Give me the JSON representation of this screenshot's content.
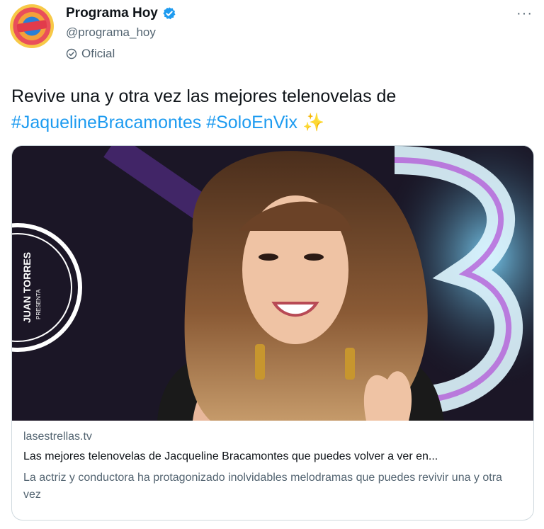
{
  "tweet": {
    "author_name": "Programa Hoy",
    "author_handle": "@programa_hoy",
    "official_label": "Oficial",
    "more_glyph": "···",
    "text_plain": "Revive una y otra vez las mejores telenovelas de",
    "hashtags": [
      "#JaquelineBracamontes",
      "#SoloEnVix"
    ],
    "emoji": "✨"
  },
  "card": {
    "domain": "lasestrellas.tv",
    "title": "Las mejores telenovelas de Jacqueline Bracamontes que puedes volver a ver en...",
    "description": "La actriz y conductora ha protagonizado inolvidables melodramas que puedes revivir una y otra vez",
    "image_backdrop_text": [
      "JUAN TORRES",
      "PRESENTA"
    ]
  },
  "colors": {
    "link": "#1d9bf0",
    "verified": "#1d9bf0",
    "muted": "#536471",
    "border": "#cfd9de"
  }
}
